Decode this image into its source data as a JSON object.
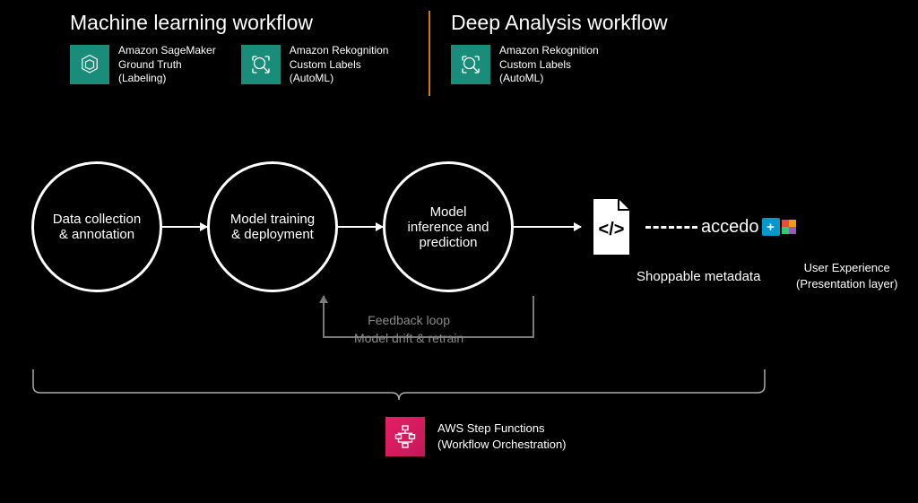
{
  "headers": {
    "left_title": "Machine learning workflow",
    "right_title": "Deep Analysis workflow"
  },
  "services": {
    "sagemaker": {
      "line1": "Amazon SageMaker",
      "line2": "Ground Truth",
      "line3": "(Labeling)"
    },
    "rekognition": {
      "line1": "Amazon Rekognition",
      "line2": "Custom Labels",
      "line3": "(AutoML)"
    }
  },
  "nodes": {
    "n1": "Data collection & annotation",
    "n2": "Model training & deployment",
    "n3": "Model inference and prediction"
  },
  "doc_label": "Shoppable metadata",
  "accedo": "accedo",
  "ux": {
    "line1": "User Experience",
    "line2": "(Presentation layer)"
  },
  "feedback": {
    "line1": "Feedback loop",
    "line2": "Model drift & retrain"
  },
  "stepfn": {
    "line1": "AWS Step Functions",
    "line2": "(Workflow Orchestration)"
  }
}
